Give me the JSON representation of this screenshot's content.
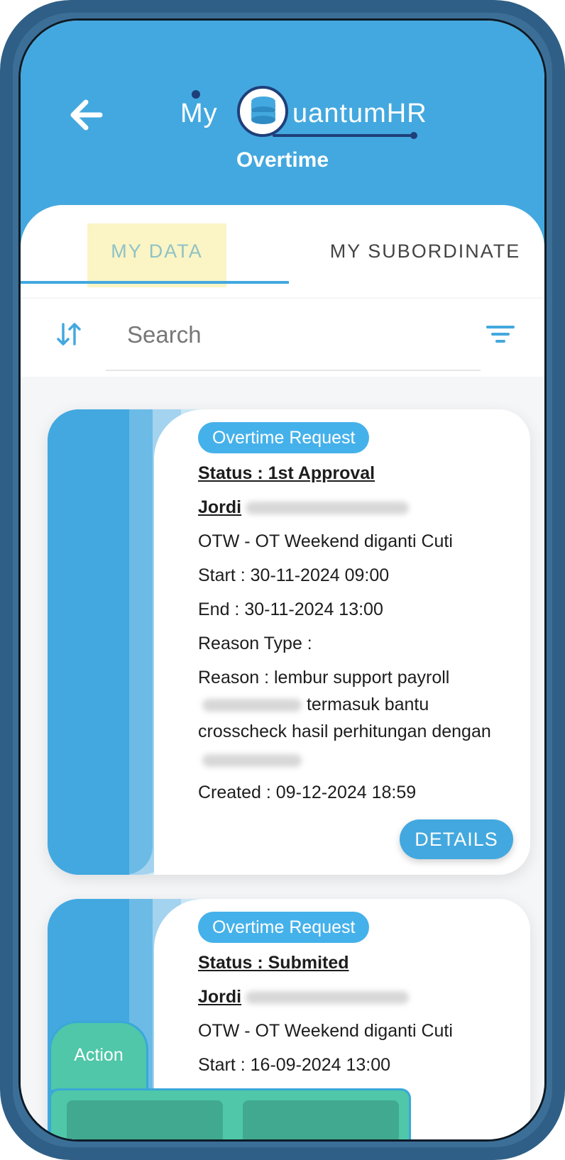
{
  "header": {
    "logo_my": "My",
    "logo_rest": "uantumHR",
    "subtitle": "Overtime"
  },
  "tabs": [
    {
      "label": "MY DATA",
      "active": true
    },
    {
      "label": "MY SUBORDINATE",
      "active": false
    }
  ],
  "search": {
    "placeholder": "Search"
  },
  "cards": [
    {
      "badge": "Overtime Request",
      "status": "Status : 1st Approval",
      "name": "Jordi",
      "type": "OTW - OT Weekend diganti Cuti",
      "start": "Start : 30-11-2024 09:00",
      "end": "End : 30-11-2024 13:00",
      "reason_type": "Reason Type :",
      "reason_line1": "Reason : lembur support payroll",
      "reason_line2": "termasuk bantu",
      "reason_line3": "crosscheck hasil perhitungan dengan",
      "created": "Created : 09-12-2024 18:59",
      "details_label": "DETAILS"
    },
    {
      "badge": "Overtime Request",
      "status": "Status : Submited",
      "name": "Jordi",
      "type": "OTW - OT Weekend diganti Cuti",
      "start": "Start : 16-09-2024 13:00"
    }
  ],
  "action": {
    "label": "Action"
  },
  "colors": {
    "primary": "#43a8df",
    "badge": "#45b1ea",
    "action": "#4fc7a8",
    "frame": "#2f5f86"
  },
  "icons": {
    "back": "arrow-left-icon",
    "sort": "sort-arrows-icon",
    "filter": "filter-icon",
    "logo": "database-icon"
  }
}
